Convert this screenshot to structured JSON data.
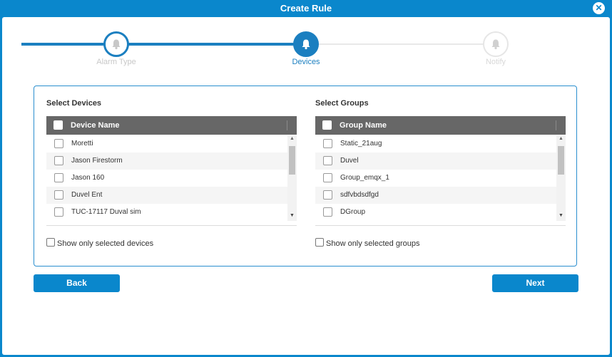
{
  "window": {
    "title": "Create Rule",
    "close_symbol": "✕"
  },
  "stepper": {
    "steps": [
      {
        "label": "Alarm Type",
        "state": "completed"
      },
      {
        "label": "Devices",
        "state": "active"
      },
      {
        "label": "Notify",
        "state": "pending"
      }
    ],
    "icon": "bell-icon",
    "colors": {
      "active": "#1b7fc0",
      "inactive": "#e6e6e6"
    }
  },
  "devices": {
    "title": "Select Devices",
    "column_header": "Device Name",
    "rows": [
      "Moretti",
      "Jason Firestorm",
      "Jason 160",
      "Duvel Ent",
      "TUC-17117 Duval sim"
    ],
    "show_only_label": "Show only selected devices"
  },
  "groups": {
    "title": "Select Groups",
    "column_header": "Group Name",
    "rows": [
      "Static_21aug",
      "Duvel",
      "Group_emqx_1",
      "sdfvbdsdfgd",
      "DGroup"
    ],
    "show_only_label": "Show only selected groups"
  },
  "scroll": {
    "up": "▲",
    "down": "▼"
  },
  "buttons": {
    "back": "Back",
    "next": "Next"
  },
  "colors": {
    "primary": "#0a87cc",
    "header": "#676767"
  }
}
